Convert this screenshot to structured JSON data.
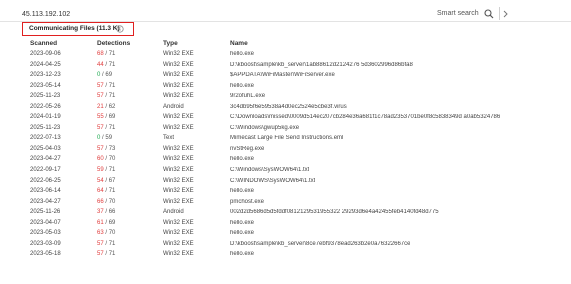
{
  "colors": {
    "accent_red": "#e02020",
    "detection_positive": "#e03c3c",
    "detection_clean": "#1eaa50"
  },
  "topbar": {
    "search_value": "45.113.192.102",
    "smart_search_label": "Smart search",
    "search_icon": "search-icon"
  },
  "section": {
    "title": "Communicating Files",
    "count": "(11.3 K)",
    "info_icon": "info-icon"
  },
  "table": {
    "columns": [
      "Scanned",
      "Detections",
      "Type",
      "Name"
    ],
    "rows": [
      {
        "date": "2023-09-06",
        "pos": "68",
        "total": "71",
        "type": "Win32 EXE",
        "name": "hello.exe"
      },
      {
        "date": "2024-04-25",
        "pos": "44",
        "total": "71",
        "type": "Win32 EXE",
        "name": "D:\\kboost\\sample\\kb_server\\1ab88612d2124276 5d3602996d86bfa8"
      },
      {
        "date": "2023-12-23",
        "pos": "0",
        "total": "69",
        "type": "Win32 EXE",
        "name": "$APPDATA\\WiFiMaster\\WiFiServer.exe"
      },
      {
        "date": "2023-05-14",
        "pos": "57",
        "total": "71",
        "type": "Win32 EXE",
        "name": "hello.exe"
      },
      {
        "date": "2025-11-23",
        "pos": "57",
        "total": "71",
        "type": "Win32 EXE",
        "name": "9r2ofuhL.exe"
      },
      {
        "date": "2022-05-26",
        "pos": "21",
        "total": "62",
        "type": "Android",
        "name": "3c4db95f6e59538a4d0ec2524e5cbe3f.virus"
      },
      {
        "date": "2024-01-19",
        "pos": "55",
        "total": "69",
        "type": "Win32 EXE",
        "name": "C:\\Downloads\\missed\\0009d514ec207cb284e36a681f1c78ad2353701be0f8c5838349d a0ab5324786"
      },
      {
        "date": "2025-11-23",
        "pos": "57",
        "total": "71",
        "type": "Win32 EXE",
        "name": "C:\\Windows\\gwup5kg.exe"
      },
      {
        "date": "2022-07-13",
        "pos": "0",
        "total": "59",
        "type": "Text",
        "name": "Mimecast Large File Send Instructions.eml"
      },
      {
        "date": "2025-04-03",
        "pos": "57",
        "total": "73",
        "type": "Win32 EXE",
        "name": "nvStReg.exe"
      },
      {
        "date": "2023-04-27",
        "pos": "60",
        "total": "70",
        "type": "Win32 EXE",
        "name": "hello.exe"
      },
      {
        "date": "2022-09-17",
        "pos": "59",
        "total": "71",
        "type": "Win32 EXE",
        "name": "C:\\Windows\\SysWOW64\\1.txt"
      },
      {
        "date": "2022-06-25",
        "pos": "54",
        "total": "67",
        "type": "Win32 EXE",
        "name": "C:\\WINDOWS\\SysWOW64\\1.txt"
      },
      {
        "date": "2023-06-14",
        "pos": "64",
        "total": "71",
        "type": "Win32 EXE",
        "name": "hello.exe"
      },
      {
        "date": "2023-04-27",
        "pos": "66",
        "total": "70",
        "type": "Win32 EXE",
        "name": "pmchost.exe"
      },
      {
        "date": "2025-11-26",
        "pos": "37",
        "total": "66",
        "type": "Android",
        "name": "002d2d5686d5d5fddf0812129531955322 29293d6e4a42455feb4140fd48d775"
      },
      {
        "date": "2023-04-07",
        "pos": "61",
        "total": "69",
        "type": "Win32 EXE",
        "name": "hello.exe"
      },
      {
        "date": "2023-05-03",
        "pos": "63",
        "total": "70",
        "type": "Win32 EXE",
        "name": "hello.exe"
      },
      {
        "date": "2023-03-09",
        "pos": "57",
        "total": "71",
        "type": "Win32 EXE",
        "name": "D:\\kboost\\sample\\kb_server\\8ce7ebf9378ead263b2e0a76322667ce"
      },
      {
        "date": "2023-05-18",
        "pos": "57",
        "total": "71",
        "type": "Win32 EXE",
        "name": "hello.exe"
      }
    ]
  }
}
